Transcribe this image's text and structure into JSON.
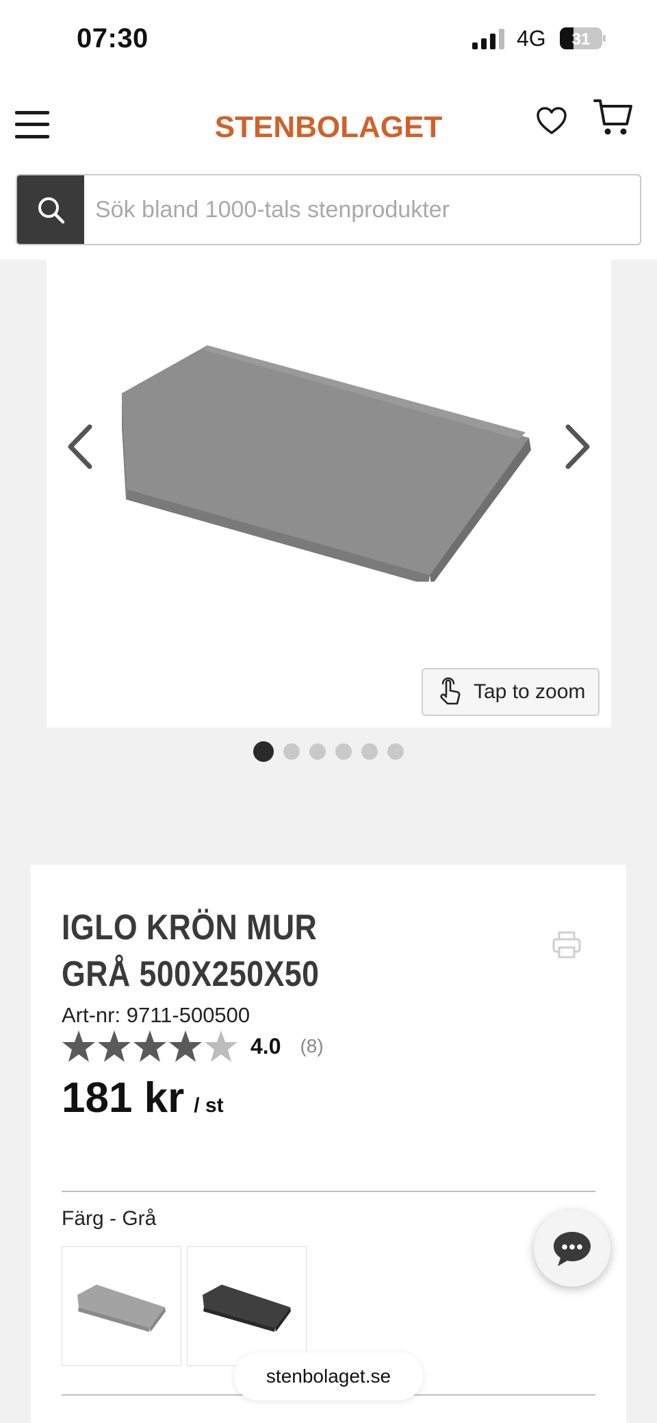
{
  "status_bar": {
    "time": "07:30",
    "network": "4G",
    "battery": "31"
  },
  "header": {
    "brand": "STENBOLAGET",
    "brand_color": "#d0612a"
  },
  "search": {
    "placeholder": "Sök bland 1000-tals stenprodukter"
  },
  "gallery": {
    "zoom_label": "Tap to zoom",
    "image_count": 6,
    "active_index": 0
  },
  "product": {
    "title": "IGLO KRÖN MUR GRÅ 500X250X50",
    "art_nr": "Art-nr: 9711-500500",
    "rating_value": "4.0",
    "rating_count": "(8)",
    "rating_stars": 4,
    "price": "181 kr",
    "price_unit": "/ st",
    "color_label": "Färg - Grå",
    "color_options": [
      "Grå",
      "Svart"
    ]
  },
  "browser": {
    "url": "stenbolaget.se"
  }
}
